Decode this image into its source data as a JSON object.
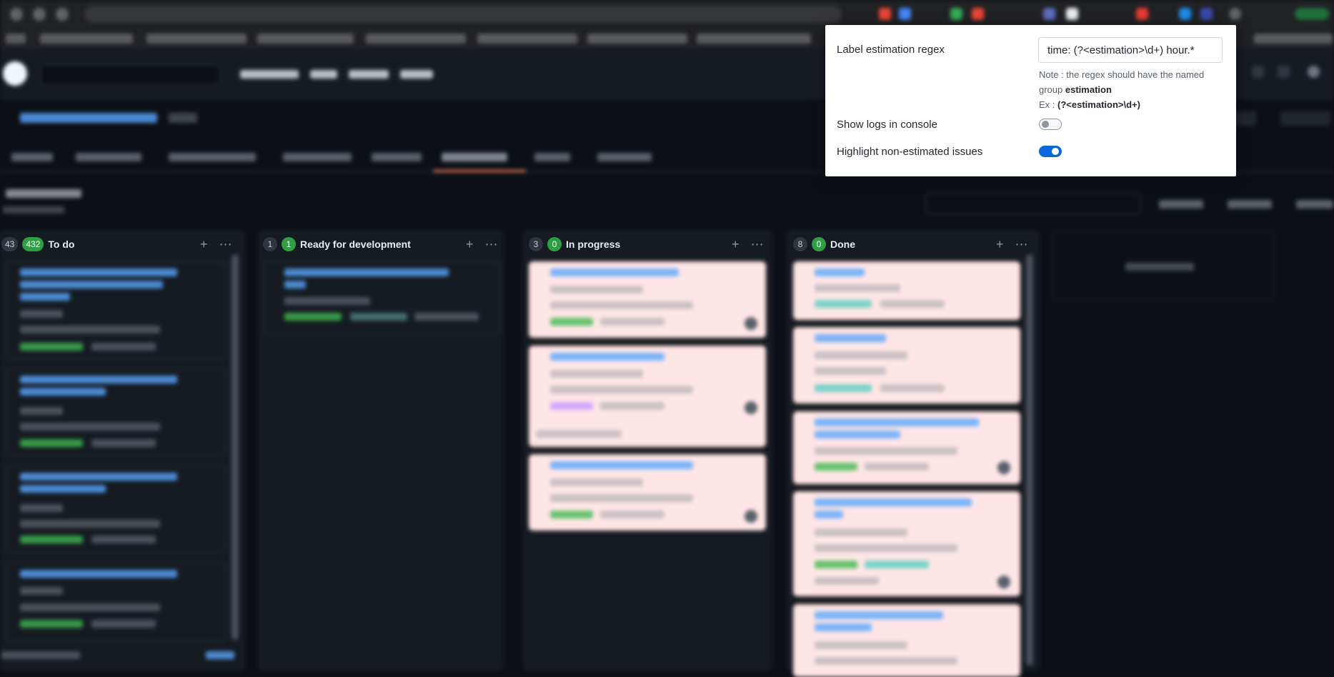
{
  "board": {
    "columns": [
      {
        "id": "todo",
        "total": "43",
        "count": "432",
        "title": "To do"
      },
      {
        "id": "ready",
        "total": "1",
        "count": "1",
        "title": "Ready for development"
      },
      {
        "id": "progress",
        "total": "3",
        "count": "0",
        "title": "In progress"
      },
      {
        "id": "done",
        "total": "8",
        "count": "0",
        "title": "Done"
      }
    ],
    "add_icon": "plus-icon",
    "menu_icon": "kebab-icon"
  },
  "settings": {
    "regex_label": "Label estimation regex",
    "regex_value": "time: (?<estimation>\\d+) hour.*",
    "note_prefix": "Note : the regex should have the named group ",
    "note_group": "estimation",
    "example_prefix": "Ex : ",
    "example_value": "(?<estimation>\\d+)",
    "logs_label": "Show logs in console",
    "logs_enabled": false,
    "highlight_label": "Highlight non-estimated issues",
    "highlight_enabled": true
  },
  "colors": {
    "page_bg": "#0d1117",
    "count_badge": "#2ea043",
    "toggle_on": "#0969da",
    "highlight_card": "#ffe6e6"
  }
}
